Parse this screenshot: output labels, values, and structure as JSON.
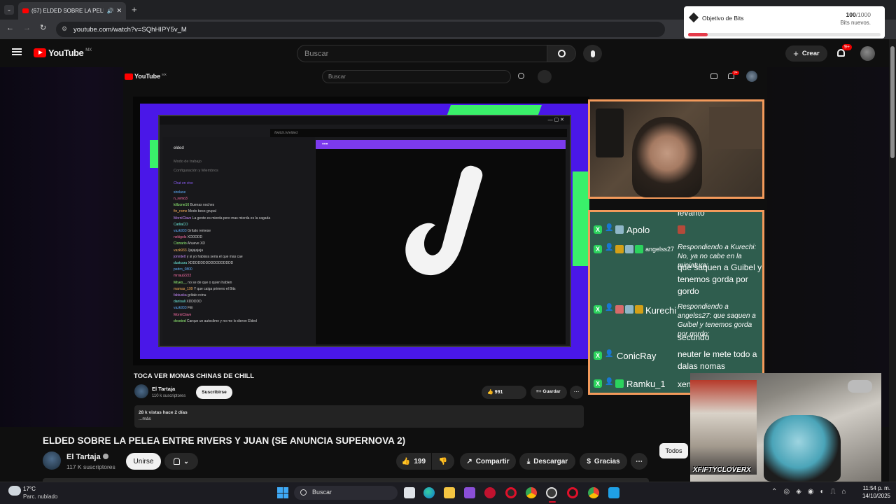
{
  "browser": {
    "tab_title": "(67) ELDED SOBRE LA PELEA ENTRE RIVERS Y JUAN (SE ANUNCIA SUPERNOVA 2)",
    "url": "youtube.com/watch?v=SQhHIPY5v_M"
  },
  "bits_toast": {
    "label": "Objetivo de Bits",
    "count": "100",
    "goal": "/1000",
    "sub": "Bits nuevos.",
    "progress": 0.1
  },
  "header": {
    "logo": "YouTube",
    "region": "MX",
    "search_placeholder": "Buscar",
    "create_label": "Crear",
    "notif_count": "9+"
  },
  "embedded": {
    "logo": "YouTube",
    "region": "MX",
    "search_placeholder": "Buscar",
    "notif_count": "9+",
    "stream_url": "/twitch.tv/elded",
    "sidebar_channel": "elded",
    "sidebar_items": [
      "Modo de trabajo",
      "Configuración y Miembros"
    ],
    "chat_label": "Chat en vivo",
    "chat_lines": [
      [
        "sirelaxe",
        ""
      ],
      [
        "n_remo3",
        ""
      ],
      [
        "killzone16",
        "Buenas noches"
      ],
      [
        "fin_rome",
        "Modo beso grupal"
      ],
      [
        "MorniClave",
        "La gente es mierda pero mas mierda es la cagada"
      ],
      [
        "CarliaCO",
        ""
      ],
      [
        "vazk933",
        "Grítalo remese"
      ],
      [
        "nekigols",
        "XDDDDD"
      ],
      [
        "Cionario",
        "Ahueve XD"
      ],
      [
        "vazk933",
        "Jjajajajaja"
      ],
      [
        "jonnite0",
        "y si yo hablara seria el que mas cae"
      ],
      [
        "dustcuru",
        "XDDDDDDDDDDDDDDDDD"
      ],
      [
        "pedro_0800",
        ""
      ],
      [
        "mrraul2222",
        ""
      ],
      [
        "Miyeo__",
        "no se de que o quien hablen"
      ],
      [
        "mamas_199",
        "Y que caiga primero el Bits"
      ],
      [
        "fabiuska",
        "grítalo reinu"
      ],
      [
        "danisali",
        "XDDDDD"
      ],
      [
        "vazk933",
        "Fiiii"
      ],
      [
        "MorniClave",
        ""
      ],
      [
        "dvsoted",
        "Carque un autoclime y no me lo dieron Elded"
      ]
    ],
    "video_title": "TOCA VER MONAS CHINAS DE CHILL",
    "channel": "El Tartaja",
    "subs": "110 k suscriptores",
    "subscribe": "Suscribirse",
    "likes": "991",
    "save": "Guardar",
    "views": "28 k vistas  hace 2 días",
    "more": "...más"
  },
  "stream_chat": [
    {
      "user": "",
      "msg": "levanto"
    },
    {
      "user": "Apolo",
      "msg": ""
    },
    {
      "user": "angelss27",
      "msg": "que saquen a Guibel y tenemos gorda por gordo",
      "reply": "Respondiendo a Kurechi: No, ya no cabe en la miniatura:"
    },
    {
      "user": "Kurechi",
      "msg": "secundo",
      "reply": "Respondiendo a angelss27: que saquen a Guibel y tenemos gorda por gordo:"
    },
    {
      "user": "ConicRay",
      "msg": "neuter le mete todo a dalas nomas"
    },
    {
      "user": "Ramku_1",
      "msg": "xenc"
    }
  ],
  "cam_overlay": "XFIFTYCLOVERX",
  "video": {
    "title": "ELDED SOBRE LA PELEA ENTRE RIVERS Y JUAN (SE ANUNCIA SUPERNOVA 2)",
    "channel": "El Tartaja",
    "subscribers": "117 K suscriptores",
    "join": "Unirse",
    "likes": "199",
    "share": "Compartir",
    "download": "Descargar",
    "thanks": "Gracias",
    "filter_all": "Todos"
  },
  "taskbar": {
    "weather_temp": "17°C",
    "weather_desc": "Parc. nublado",
    "search": "Buscar",
    "time": "11:54 p. m.",
    "date": "14/10/2025"
  }
}
